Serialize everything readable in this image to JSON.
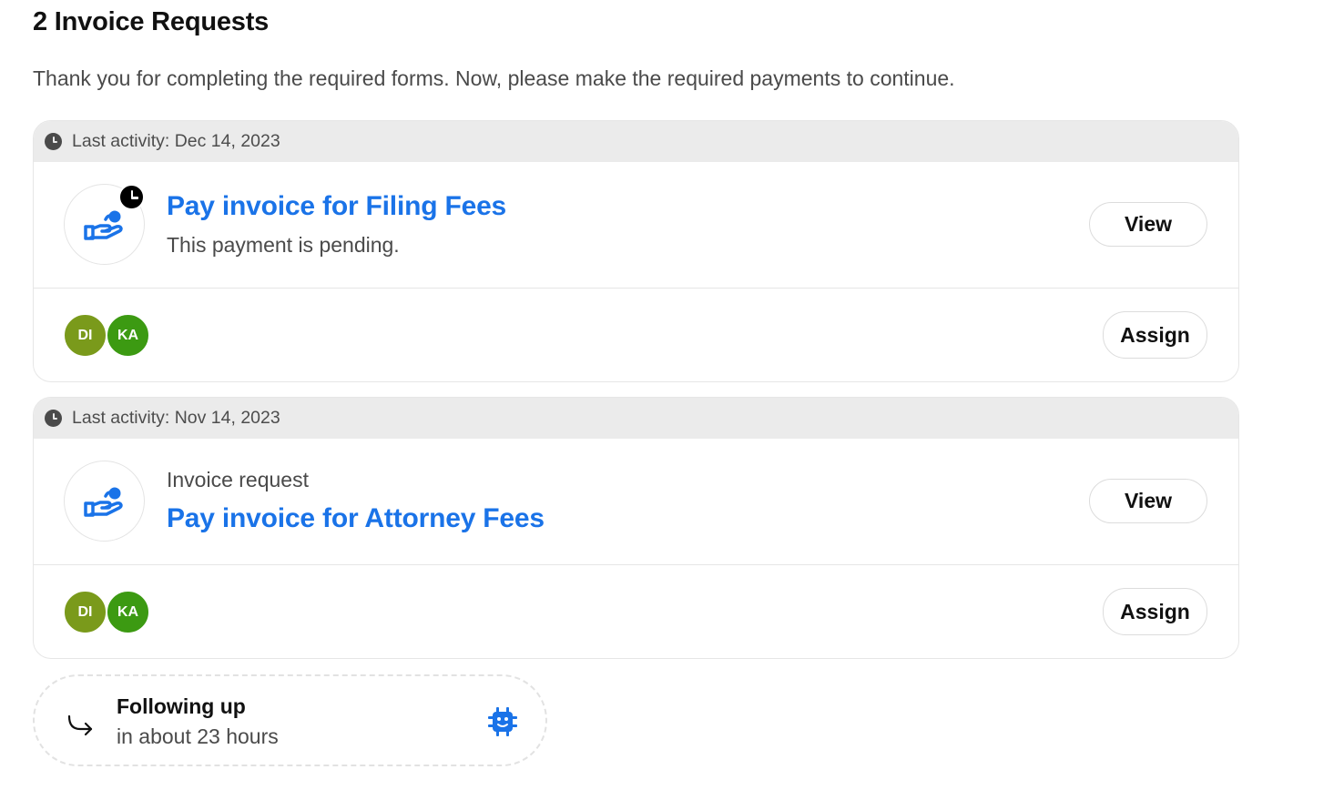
{
  "page": {
    "title": "2 Invoice Requests",
    "subtitle": "Thank you for completing the required forms. Now, please make the required payments to continue."
  },
  "invoices": [
    {
      "last_activity": "Last activity: Dec 14, 2023",
      "title": "Pay invoice for Filing Fees",
      "description": "This payment is pending.",
      "status": "pending",
      "view_label": "View",
      "assign_label": "Assign",
      "assignees": [
        {
          "initials": "DI",
          "color": "#7a9a1b"
        },
        {
          "initials": "KA",
          "color": "#3c9a12"
        }
      ]
    },
    {
      "last_activity": "Last activity: Nov 14, 2023",
      "kind": "Invoice request",
      "title": "Pay invoice for Attorney Fees",
      "view_label": "View",
      "assign_label": "Assign",
      "assignees": [
        {
          "initials": "DI",
          "color": "#7a9a1b"
        },
        {
          "initials": "KA",
          "color": "#3c9a12"
        }
      ]
    }
  ],
  "followup": {
    "title": "Following up",
    "subtitle": "in about 23 hours",
    "icons": [
      "arrow-return-icon",
      "bot-icon"
    ]
  },
  "colors": {
    "accent": "#1a73e8",
    "header_bg": "#ebebeb",
    "border": "#e6e6e6"
  }
}
